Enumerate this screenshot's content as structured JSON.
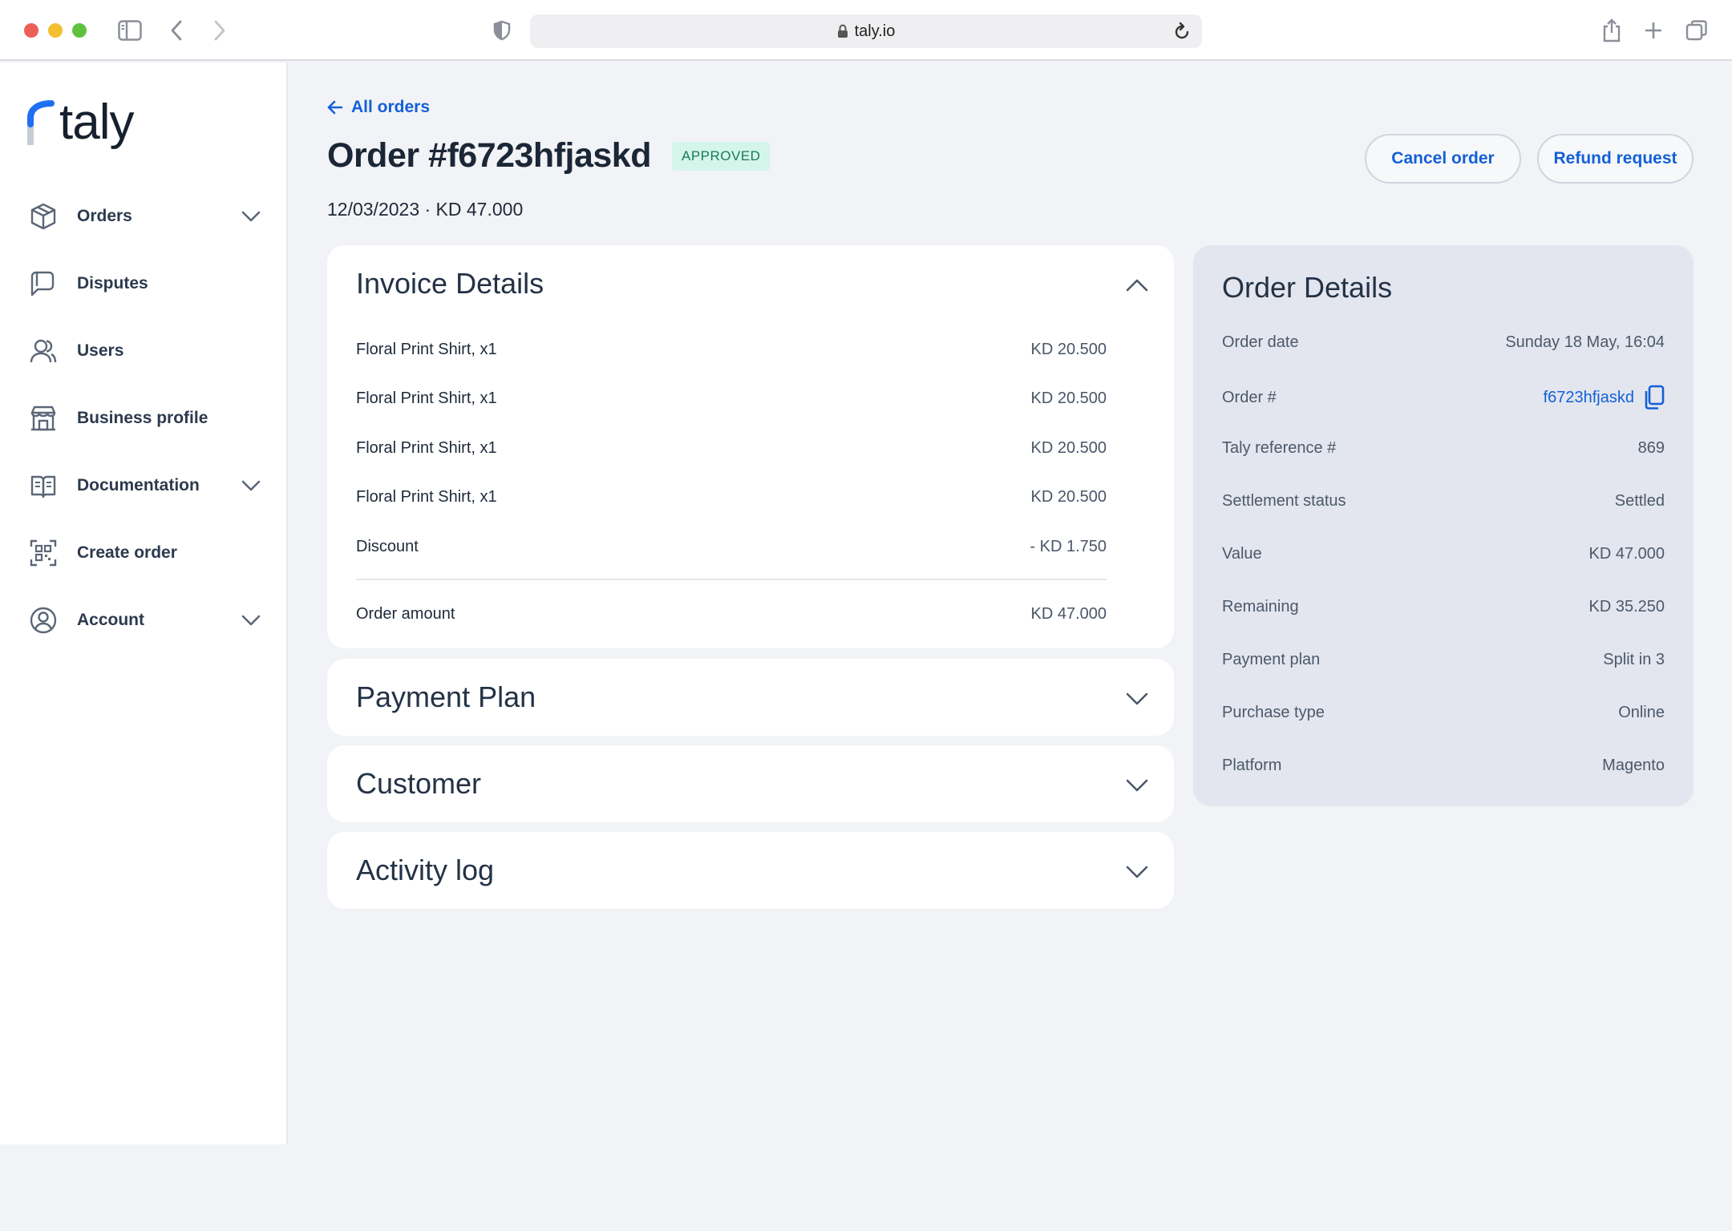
{
  "browser": {
    "url": "taly.io"
  },
  "sidebar": {
    "logo": "taly",
    "items": [
      {
        "label": "Orders",
        "icon": "box-icon",
        "has_chevron": true
      },
      {
        "label": "Disputes",
        "icon": "chat-bubble-icon",
        "has_chevron": false
      },
      {
        "label": "Users",
        "icon": "users-icon",
        "has_chevron": false
      },
      {
        "label": "Business profile",
        "icon": "storefront-icon",
        "has_chevron": false
      },
      {
        "label": "Documentation",
        "icon": "book-icon",
        "has_chevron": true
      },
      {
        "label": "Create order",
        "icon": "qr-code-icon",
        "has_chevron": false
      },
      {
        "label": "Account",
        "icon": "user-circle-icon",
        "has_chevron": true
      }
    ]
  },
  "header": {
    "back_label": "All orders",
    "title": "Order #f6723hfjaskd",
    "status": "APPROVED",
    "subtitle": "12/03/2023 · KD 47.000",
    "cancel_label": "Cancel order",
    "refund_label": "Refund request"
  },
  "invoice": {
    "title": "Invoice Details",
    "rows": [
      {
        "label": "Floral Print Shirt, x1",
        "amount": "KD 20.500"
      },
      {
        "label": "Floral Print Shirt, x1",
        "amount": "KD 20.500"
      },
      {
        "label": "Floral Print Shirt, x1",
        "amount": "KD 20.500"
      },
      {
        "label": "Floral Print Shirt, x1",
        "amount": "KD 20.500"
      },
      {
        "label": "Discount",
        "amount": "- KD 1.750"
      }
    ],
    "total_label": "Order amount",
    "total_amount": "KD 47.000"
  },
  "sections": {
    "payment_plan": "Payment Plan",
    "customer": "Customer",
    "activity_log": "Activity log"
  },
  "order_details": {
    "title": "Order Details",
    "rows": [
      {
        "label": "Order date",
        "value": "Sunday 18 May, 16:04"
      },
      {
        "label": "Order #",
        "value": "f6723hfjaskd"
      },
      {
        "label": "Taly reference #",
        "value": "869"
      },
      {
        "label": "Settlement status",
        "value": "Settled"
      },
      {
        "label": "Value",
        "value": "KD 47.000"
      },
      {
        "label": "Remaining",
        "value": "KD 35.250"
      },
      {
        "label": "Payment plan",
        "value": "Split in 3"
      },
      {
        "label": "Purchase type",
        "value": "Online"
      },
      {
        "label": "Platform",
        "value": "Magento"
      }
    ]
  },
  "colors": {
    "accent": "#1360d8",
    "status_bg": "#d4f5ea",
    "status_text": "#177a57",
    "panel_bg": "#e3e6ee"
  }
}
